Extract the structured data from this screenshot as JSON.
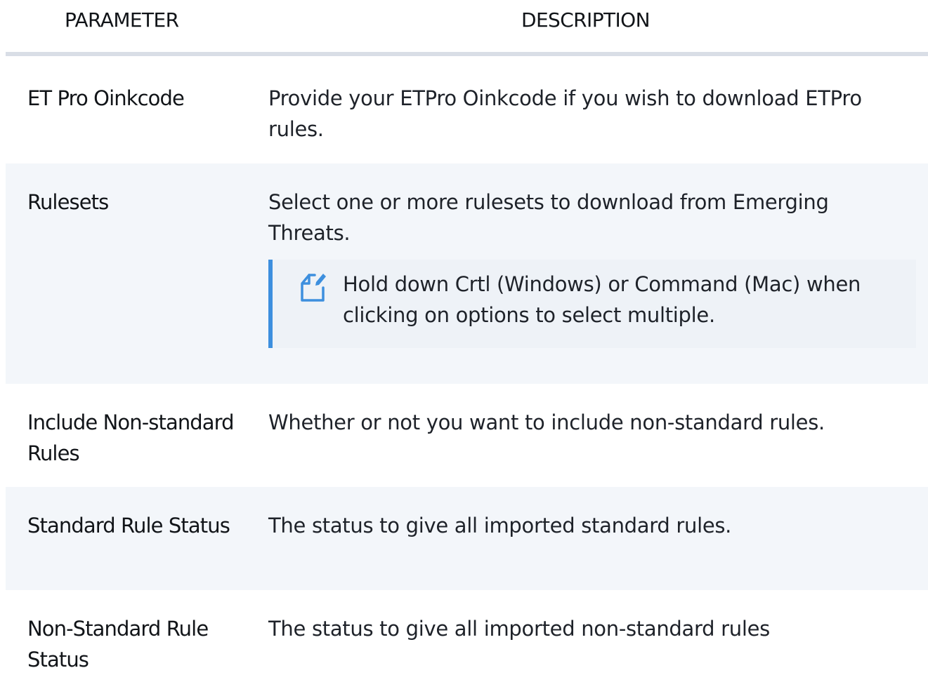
{
  "table": {
    "headers": {
      "parameter": "PARAMETER",
      "description": "DESCRIPTION"
    },
    "rows": [
      {
        "parameter": "ET Pro Oinkcode",
        "description": "Provide your ETPro Oinkcode if you wish to download ETPro rules."
      },
      {
        "parameter": "Rulesets",
        "description": "Select one or more rulesets to download from Emerging Threats.",
        "note": "Hold down Crtl (Windows) or Command (Mac) when clicking on options to select multiple."
      },
      {
        "parameter": "Include Non-standard Rules",
        "description": "Whether or not you want to include non-standard rules."
      },
      {
        "parameter": "Standard Rule Status",
        "description": "The status to give all imported standard rules."
      },
      {
        "parameter": "Non-Standard Rule Status",
        "description": "The status to give all imported non-standard rules"
      }
    ]
  },
  "colors": {
    "note_accent": "#3d8fde",
    "alt_row_background": "#f3f6fa",
    "header_rule": "#d9dee6"
  },
  "icons": {
    "note": "note-edit-icon"
  }
}
